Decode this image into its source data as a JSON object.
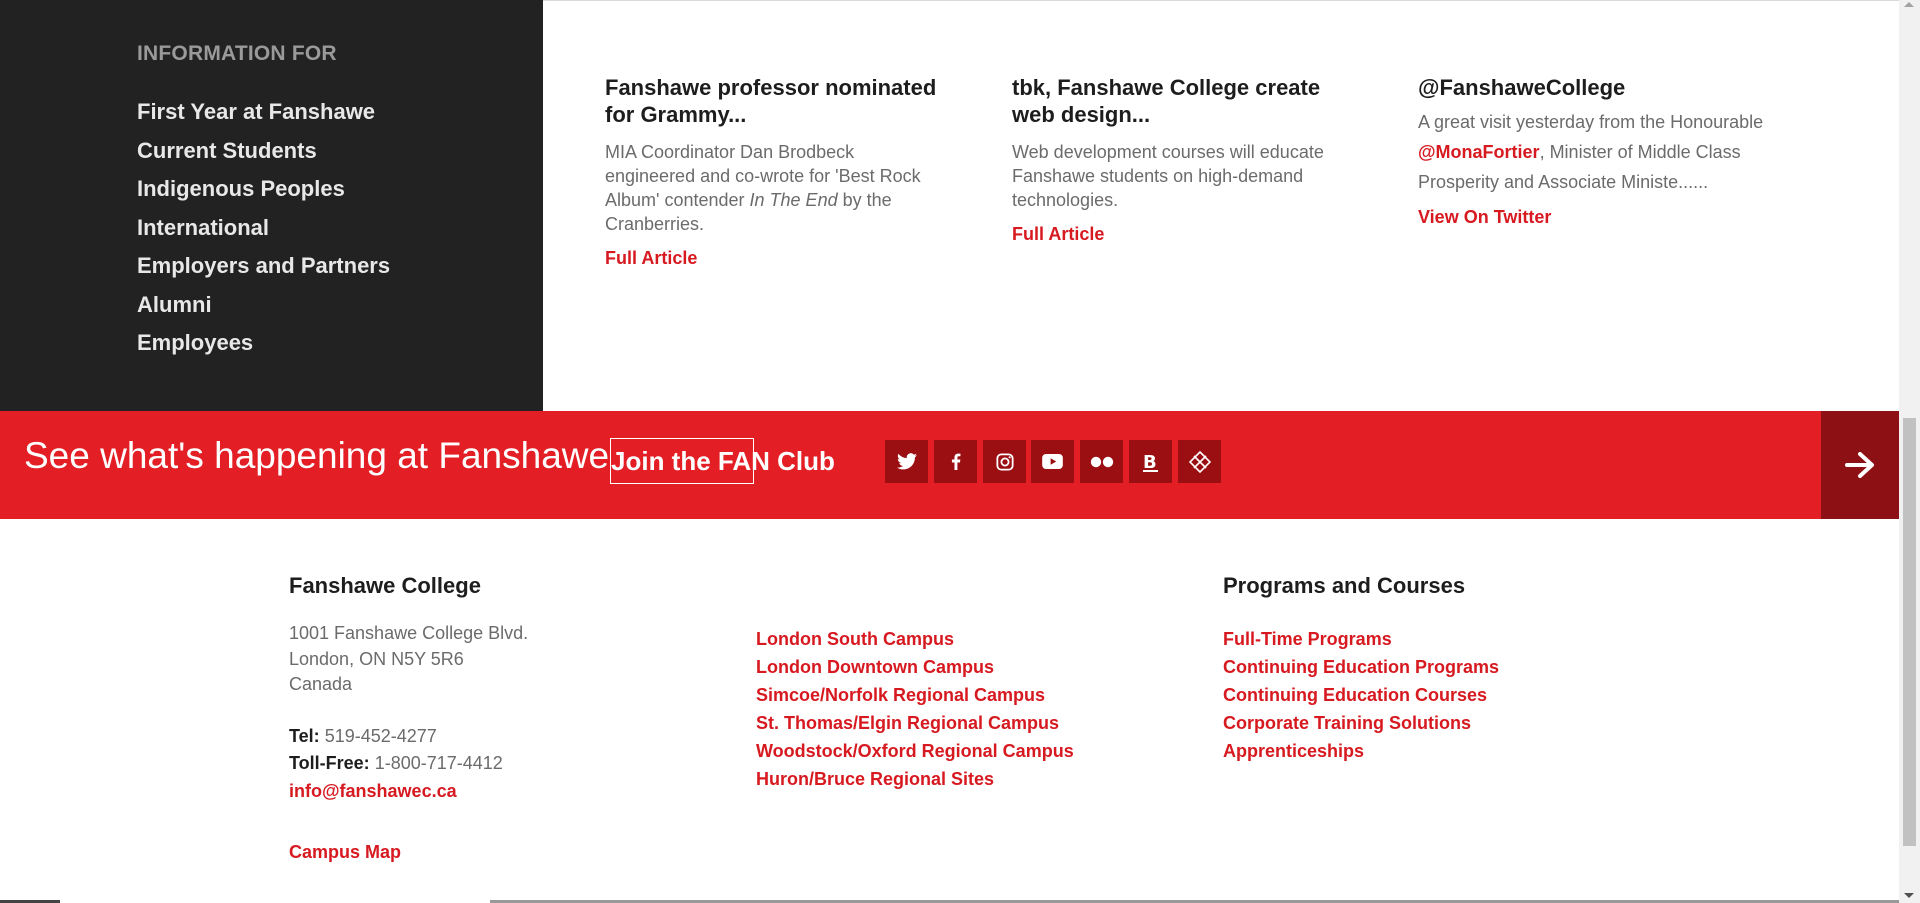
{
  "info": {
    "heading": "INFORMATION FOR",
    "items": [
      "First Year at Fanshawe",
      "Current Students",
      "Indigenous Peoples",
      "International",
      "Employers and Partners",
      "Alumni",
      "Employees"
    ]
  },
  "news": [
    {
      "title": "Fanshawe professor nominated for Grammy...",
      "body_pre": "MIA Coordinator Dan Brodbeck engineered and co-wrote for 'Best Rock Album' contender ",
      "body_em": "In The End",
      "body_post": " by the Cranberries.",
      "link": "Full Article"
    },
    {
      "title": "tbk, Fanshawe College create web design...",
      "body": "Web development courses will educate Fanshawe students on high-demand technologies.",
      "link": "Full Article"
    }
  ],
  "twitter": {
    "handle": "@FanshaweCollege",
    "body_pre": "A great visit yesterday from the Honourable ",
    "mention": "@MonaFortier",
    "body_post": ", Minister of Middle Class Prosperity and Associate Ministe......",
    "link": "View On Twitter"
  },
  "banner": {
    "text": "See what's happening at Fanshawe",
    "button": "Join the FAN Club",
    "social_icons": [
      "twitter-icon",
      "facebook-icon",
      "instagram-icon",
      "youtube-icon",
      "flickr-icon",
      "blog-icon",
      "fanshawe-icon"
    ],
    "arrow_icon": "arrow-right-icon"
  },
  "footer": {
    "college_heading": "Fanshawe College",
    "address": [
      "1001 Fanshawe College Blvd.",
      "London, ON N5Y 5R6",
      "Canada"
    ],
    "tel_label": "Tel:",
    "tel": "519-452-4277",
    "tollfree_label": "Toll-Free:",
    "tollfree": "1-800-717-4412",
    "email": "info@fanshawec.ca",
    "campus_map": "Campus Map",
    "campuses": [
      "London South Campus",
      "London Downtown Campus",
      "Simcoe/Norfolk Regional Campus",
      "St. Thomas/Elgin Regional Campus",
      "Woodstock/Oxford Regional Campus",
      "Huron/Bruce Regional Sites"
    ],
    "programs_heading": "Programs and Courses",
    "programs": [
      "Full-Time Programs",
      "Continuing Education Programs",
      "Continuing Education Courses",
      "Corporate Training Solutions",
      "Apprenticeships"
    ]
  },
  "colors": {
    "brand_red": "#e31e24",
    "dark_panel": "#222222",
    "link_red": "#d71920"
  }
}
